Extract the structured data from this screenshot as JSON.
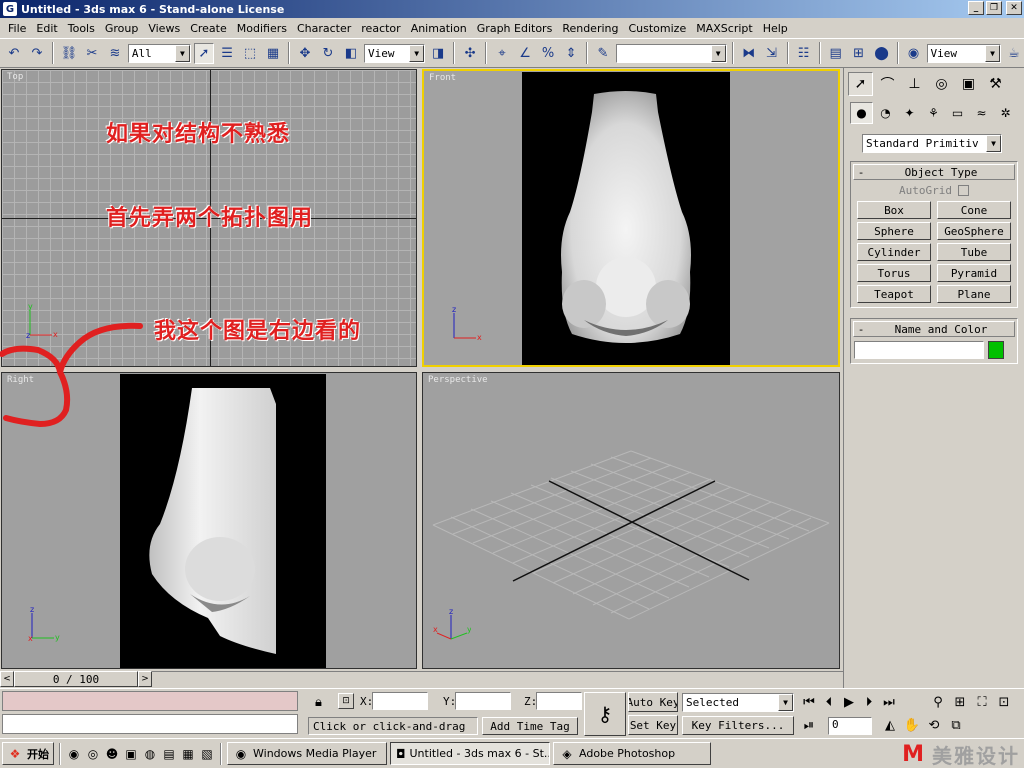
{
  "window": {
    "title": "Untitled - 3ds max 6 - Stand-alone License",
    "minimize_glyph": "_",
    "maximize_glyph": "❐",
    "close_glyph": "✕"
  },
  "menu": [
    "File",
    "Edit",
    "Tools",
    "Group",
    "Views",
    "Create",
    "Modifiers",
    "Character",
    "reactor",
    "Animation",
    "Graph Editors",
    "Rendering",
    "Customize",
    "MAXScript",
    "Help"
  ],
  "toolbar": {
    "selection_filter": "All",
    "ref_coord": "View",
    "named_sel": "",
    "view_combo": "View"
  },
  "viewports": {
    "top": {
      "label": "Top"
    },
    "front": {
      "label": "Front"
    },
    "right": {
      "label": "Right"
    },
    "perspective": {
      "label": "Perspective"
    }
  },
  "annotations": {
    "line1": "如果对结构不熟悉",
    "line2": "首先弄两个拓扑图用",
    "line3": "我这个图是右边看的"
  },
  "axis_labels": {
    "x": "x",
    "y": "y",
    "z": "z"
  },
  "command_panel": {
    "category": "Standard Primitiv",
    "object_type_title": "Object Type",
    "autogrid_label": "AutoGrid",
    "objects": [
      "Box",
      "Cone",
      "Sphere",
      "GeoSphere",
      "Cylinder",
      "Tube",
      "Torus",
      "Pyramid",
      "Teapot",
      "Plane"
    ],
    "name_color_title": "Name and Color",
    "name_value": "",
    "object_color": "#00c000",
    "collapse_glyph": "-"
  },
  "timeline": {
    "frame_display": "0 / 100"
  },
  "status": {
    "x_label": "X:",
    "y_label": "Y:",
    "z_label": "Z:",
    "prompt": "Click or click-and-drag",
    "add_time_tag": "Add Time Tag",
    "auto_key": "Auto Key",
    "set_key": "Set Key",
    "selected": "Selected",
    "key_filters": "Key Filters...",
    "current_frame": "0"
  },
  "taskbar": {
    "start": "开始",
    "tasks": [
      "Windows Media Player",
      "Untitled - 3ds max 6 - St...",
      "Adobe Photoshop"
    ],
    "watermark": "美雅设计"
  },
  "colors": {
    "annotation": "#e02020",
    "active_viewport_border": "#f0d000",
    "titlebar": "#0a246a"
  }
}
